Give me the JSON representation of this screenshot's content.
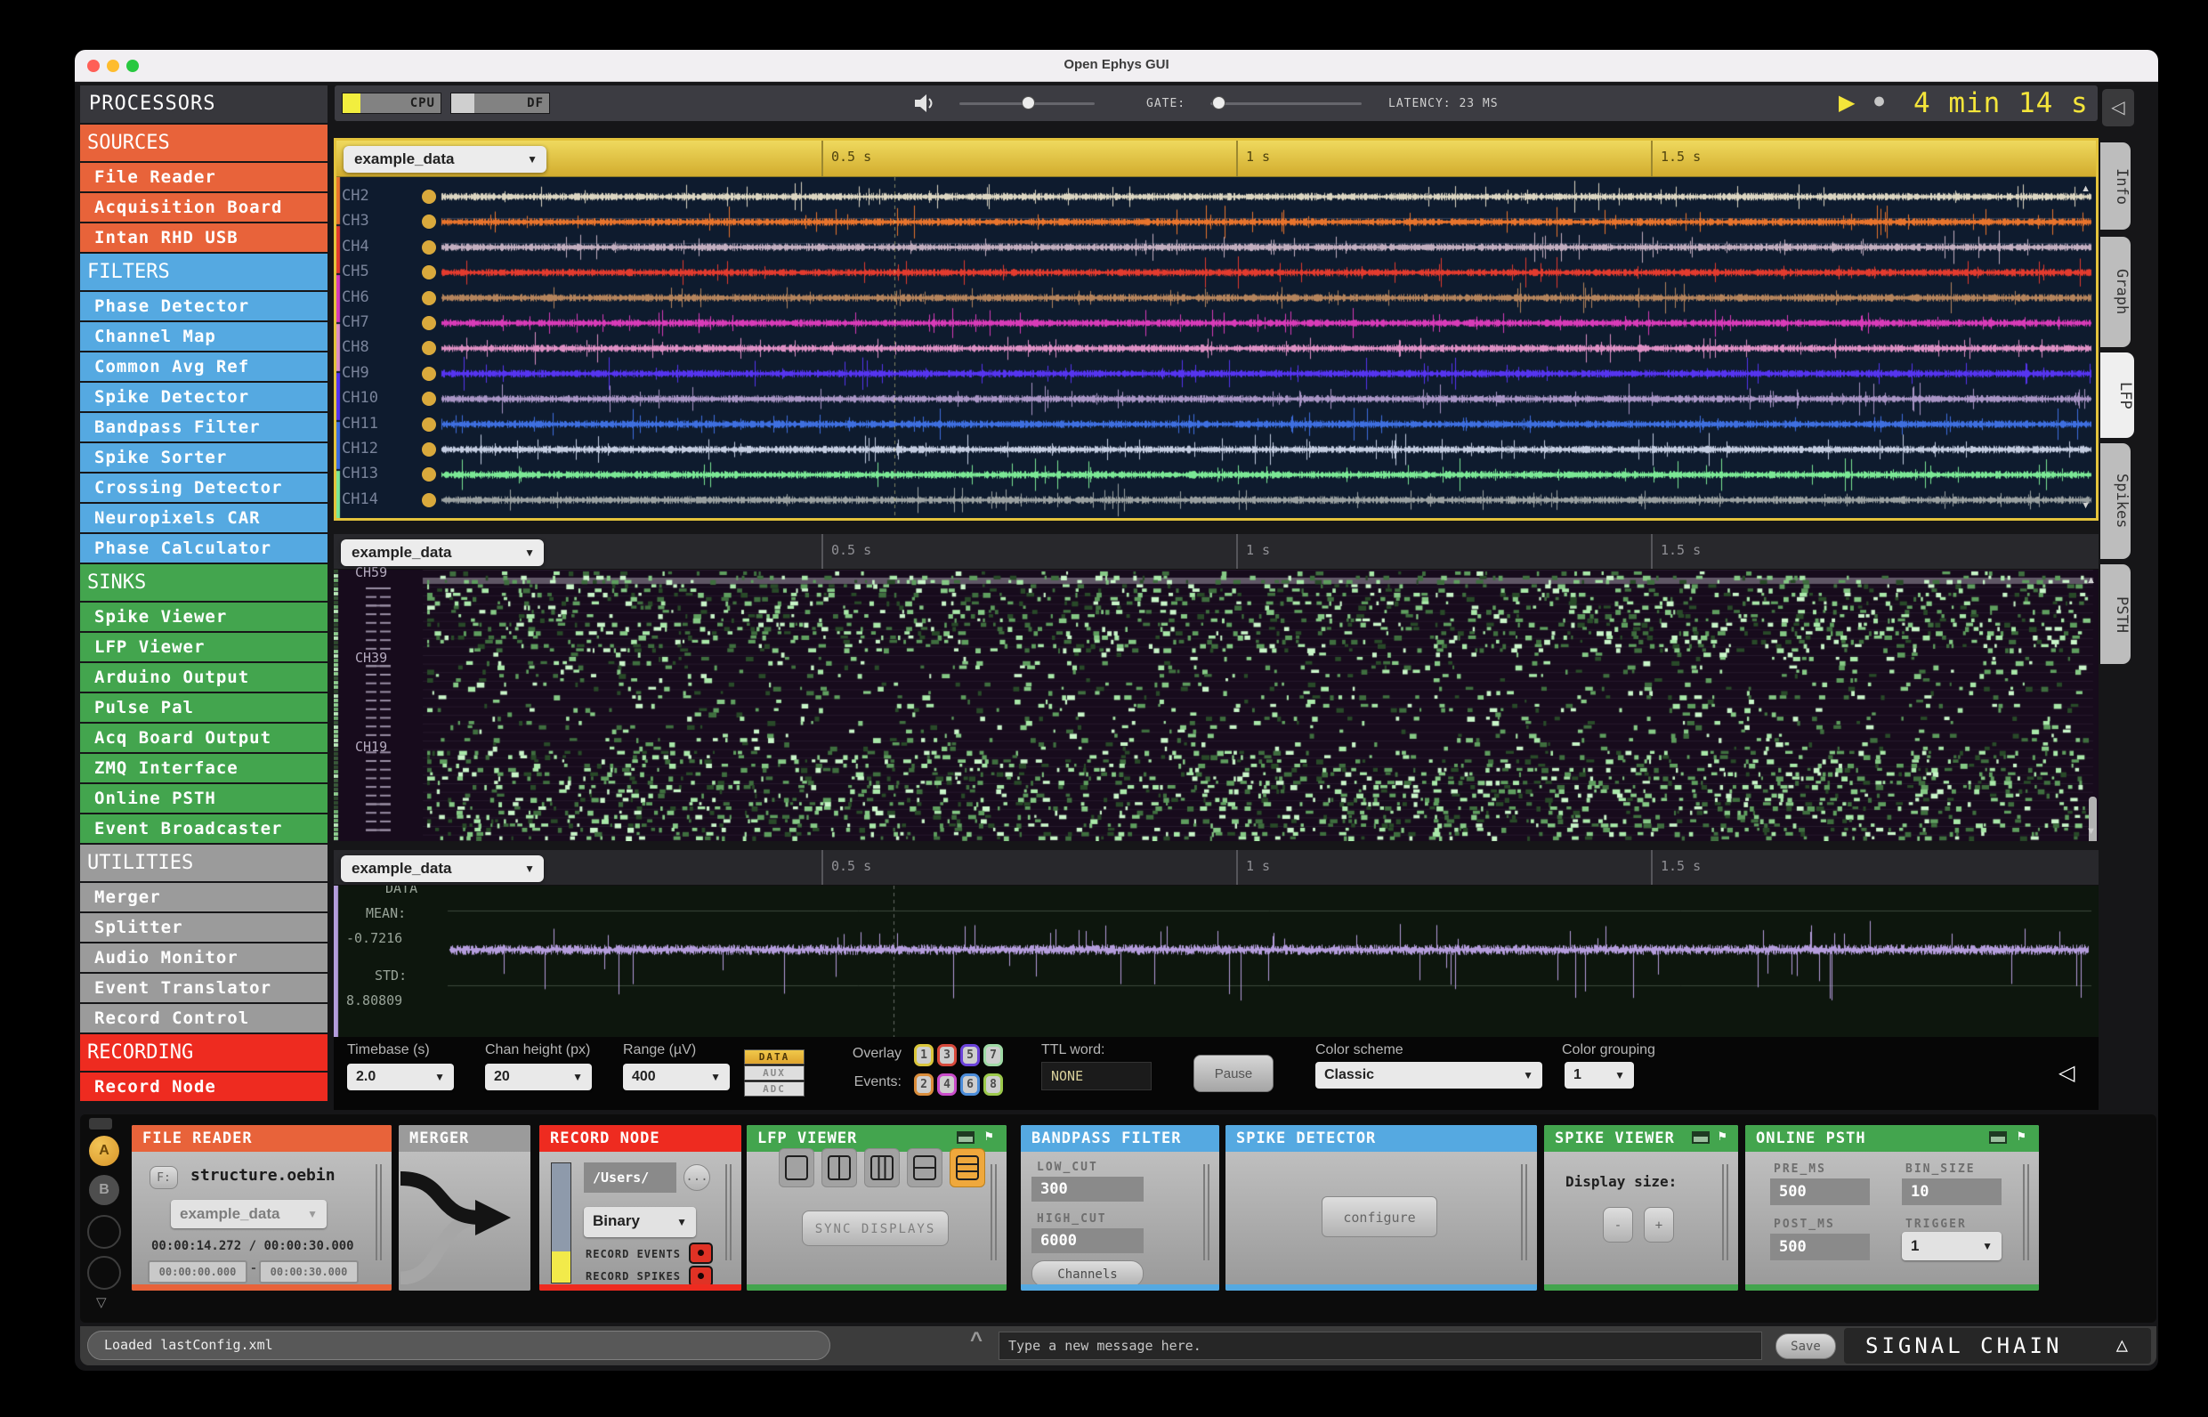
{
  "window": {
    "title": "Open Ephys GUI"
  },
  "toolbar": {
    "cpu_label": "CPU",
    "df_label": "DF",
    "gate_label": "GATE:",
    "latency_text": "LATENCY: 23 MS",
    "timer_text": "4 min 14 s"
  },
  "sidebar": {
    "title": "PROCESSORS",
    "sections": [
      {
        "label": "SOURCES",
        "color": "#E8633A",
        "items": [
          "File Reader",
          "Acquisition Board",
          "Intan RHD USB"
        ]
      },
      {
        "label": "FILTERS",
        "color": "#55A9E1",
        "items": [
          "Phase Detector",
          "Channel Map",
          "Common Avg Ref",
          "Spike Detector",
          "Bandpass Filter",
          "Spike Sorter",
          "Crossing Detector",
          "Neuropixels CAR",
          "Phase Calculator"
        ]
      },
      {
        "label": "SINKS",
        "color": "#43A54E",
        "items": [
          "Spike Viewer",
          "LFP Viewer",
          "Arduino Output",
          "Pulse Pal",
          "Acq Board Output",
          "ZMQ Interface",
          "Online PSTH",
          "Event Broadcaster"
        ]
      },
      {
        "label": "UTILITIES",
        "color": "#9B9B9B",
        "items": [
          "Merger",
          "Splitter",
          "Audio Monitor",
          "Event Translator",
          "Record Control"
        ]
      },
      {
        "label": "RECORDING",
        "color": "#EE2B20",
        "items": [
          "Record Node"
        ]
      }
    ]
  },
  "viewers": {
    "lfp": {
      "selector": "example_data",
      "ticks": [
        "0.5 s",
        "1 s",
        "1.5 s"
      ],
      "strip_colors": [
        "#E8742C",
        "#E33B2E",
        "#D83BB8",
        "#DE8FC4",
        "#5634F0",
        "#3E6FE0",
        "#7BE895"
      ],
      "channels": [
        {
          "name": "CH2",
          "color": "#DCD6C2"
        },
        {
          "name": "CH3",
          "color": "#E8742C"
        },
        {
          "name": "CH4",
          "color": "#C3AFC0"
        },
        {
          "name": "CH5",
          "color": "#E33B2E"
        },
        {
          "name": "CH6",
          "color": "#B5845C"
        },
        {
          "name": "CH7",
          "color": "#D83BB8"
        },
        {
          "name": "CH8",
          "color": "#DE8FC4"
        },
        {
          "name": "CH9",
          "color": "#5634F0"
        },
        {
          "name": "CH10",
          "color": "#A995C5"
        },
        {
          "name": "CH11",
          "color": "#3E6FE0"
        },
        {
          "name": "CH12",
          "color": "#C3CCE0"
        },
        {
          "name": "CH13",
          "color": "#7BE895"
        },
        {
          "name": "CH14",
          "color": "#9AA0A0"
        }
      ]
    },
    "raster": {
      "selector": "example_data",
      "ticks": [
        "0.5 s",
        "1 s",
        "1.5 s"
      ],
      "row_labels": [
        "CH59",
        "CH39",
        "CH19"
      ]
    },
    "data": {
      "selector": "example_data",
      "ticks": [
        "0.5 s",
        "1 s",
        "1.5 s"
      ],
      "title": "DATA",
      "mean_label": "MEAN:",
      "mean_value": "-0.7216",
      "std_label": "STD:",
      "std_value": "8.80809",
      "trace_color": "#B49DDC"
    }
  },
  "options": {
    "timebase_label": "Timebase (s)",
    "timebase_value": "2.0",
    "chan_height_label": "Chan height (px)",
    "chan_height_value": "20",
    "range_label": "Range (µV)",
    "range_value": "400",
    "signal_buttons": [
      "DATA",
      "AUX",
      "ADC"
    ],
    "overlay_label_1": "Overlay",
    "overlay_label_2": "Events:",
    "events": [
      {
        "n": "1",
        "color": "#D9C53A"
      },
      {
        "n": "3",
        "color": "#D6493B"
      },
      {
        "n": "5",
        "color": "#6B43D9"
      },
      {
        "n": "7",
        "color": "#9FD9A5"
      },
      {
        "n": "2",
        "color": "#D98C3A"
      },
      {
        "n": "4",
        "color": "#C94BC9"
      },
      {
        "n": "6",
        "color": "#4B8CD9"
      },
      {
        "n": "8",
        "color": "#9CC94B"
      }
    ],
    "ttl_label": "TTL word:",
    "ttl_value": "NONE",
    "pause_label": "Pause",
    "scheme_label": "Color scheme",
    "scheme_value": "Classic",
    "grouping_label": "Color grouping",
    "grouping_value": "1"
  },
  "tabs": [
    {
      "label": "Info"
    },
    {
      "label": "Graph"
    },
    {
      "label": "LFP",
      "selected": true
    },
    {
      "label": "Spikes"
    },
    {
      "label": "PSTH"
    }
  ],
  "chain": {
    "rail": {
      "a": "A",
      "b": "B"
    },
    "nodes": [
      {
        "title": "FILE READER",
        "color": "#E8633A",
        "f_label": "F:",
        "file": "structure.oebin",
        "selector": "example_data",
        "time_current": "00:00:14.272",
        "time_sep": "/",
        "time_total": "00:00:30.000",
        "range_start": "00:00:00.000",
        "range_sep": "-",
        "range_end": "00:00:30.000"
      },
      {
        "title": "MERGER",
        "color": "#9B9B9B"
      },
      {
        "title": "RECORD NODE",
        "color": "#EE2B20",
        "path": "/Users/",
        "more_label": "...",
        "format": "Binary",
        "toggle1": "RECORD EVENTS",
        "toggle2": "RECORD SPIKES"
      },
      {
        "title": "LFP VIEWER",
        "color": "#43A54E",
        "sync_label": "SYNC DISPLAYS"
      },
      {
        "title": "BANDPASS FILTER",
        "color": "#55A9E1",
        "low_label": "LOW_CUT",
        "low_value": "300",
        "high_label": "HIGH_CUT",
        "high_value": "6000",
        "channels_label": "Channels"
      },
      {
        "title": "SPIKE DETECTOR",
        "color": "#55A9E1",
        "configure_label": "configure"
      },
      {
        "title": "SPIKE VIEWER",
        "color": "#43A54E",
        "display_label": "Display size:",
        "minus_label": "-",
        "plus_label": "+"
      },
      {
        "title": "ONLINE PSTH",
        "color": "#43A54E",
        "pre_label": "PRE_MS",
        "pre_value": "500",
        "bin_label": "BIN_SIZE",
        "bin_value": "10",
        "post_label": "POST_MS",
        "post_value": "500",
        "trigger_label": "TRIGGER",
        "trigger_value": "1"
      }
    ]
  },
  "statusbar": {
    "message": "Loaded lastConfig.xml",
    "input_placeholder": "Type a new message here.",
    "save_label": "Save",
    "chain_label": "SIGNAL CHAIN"
  }
}
